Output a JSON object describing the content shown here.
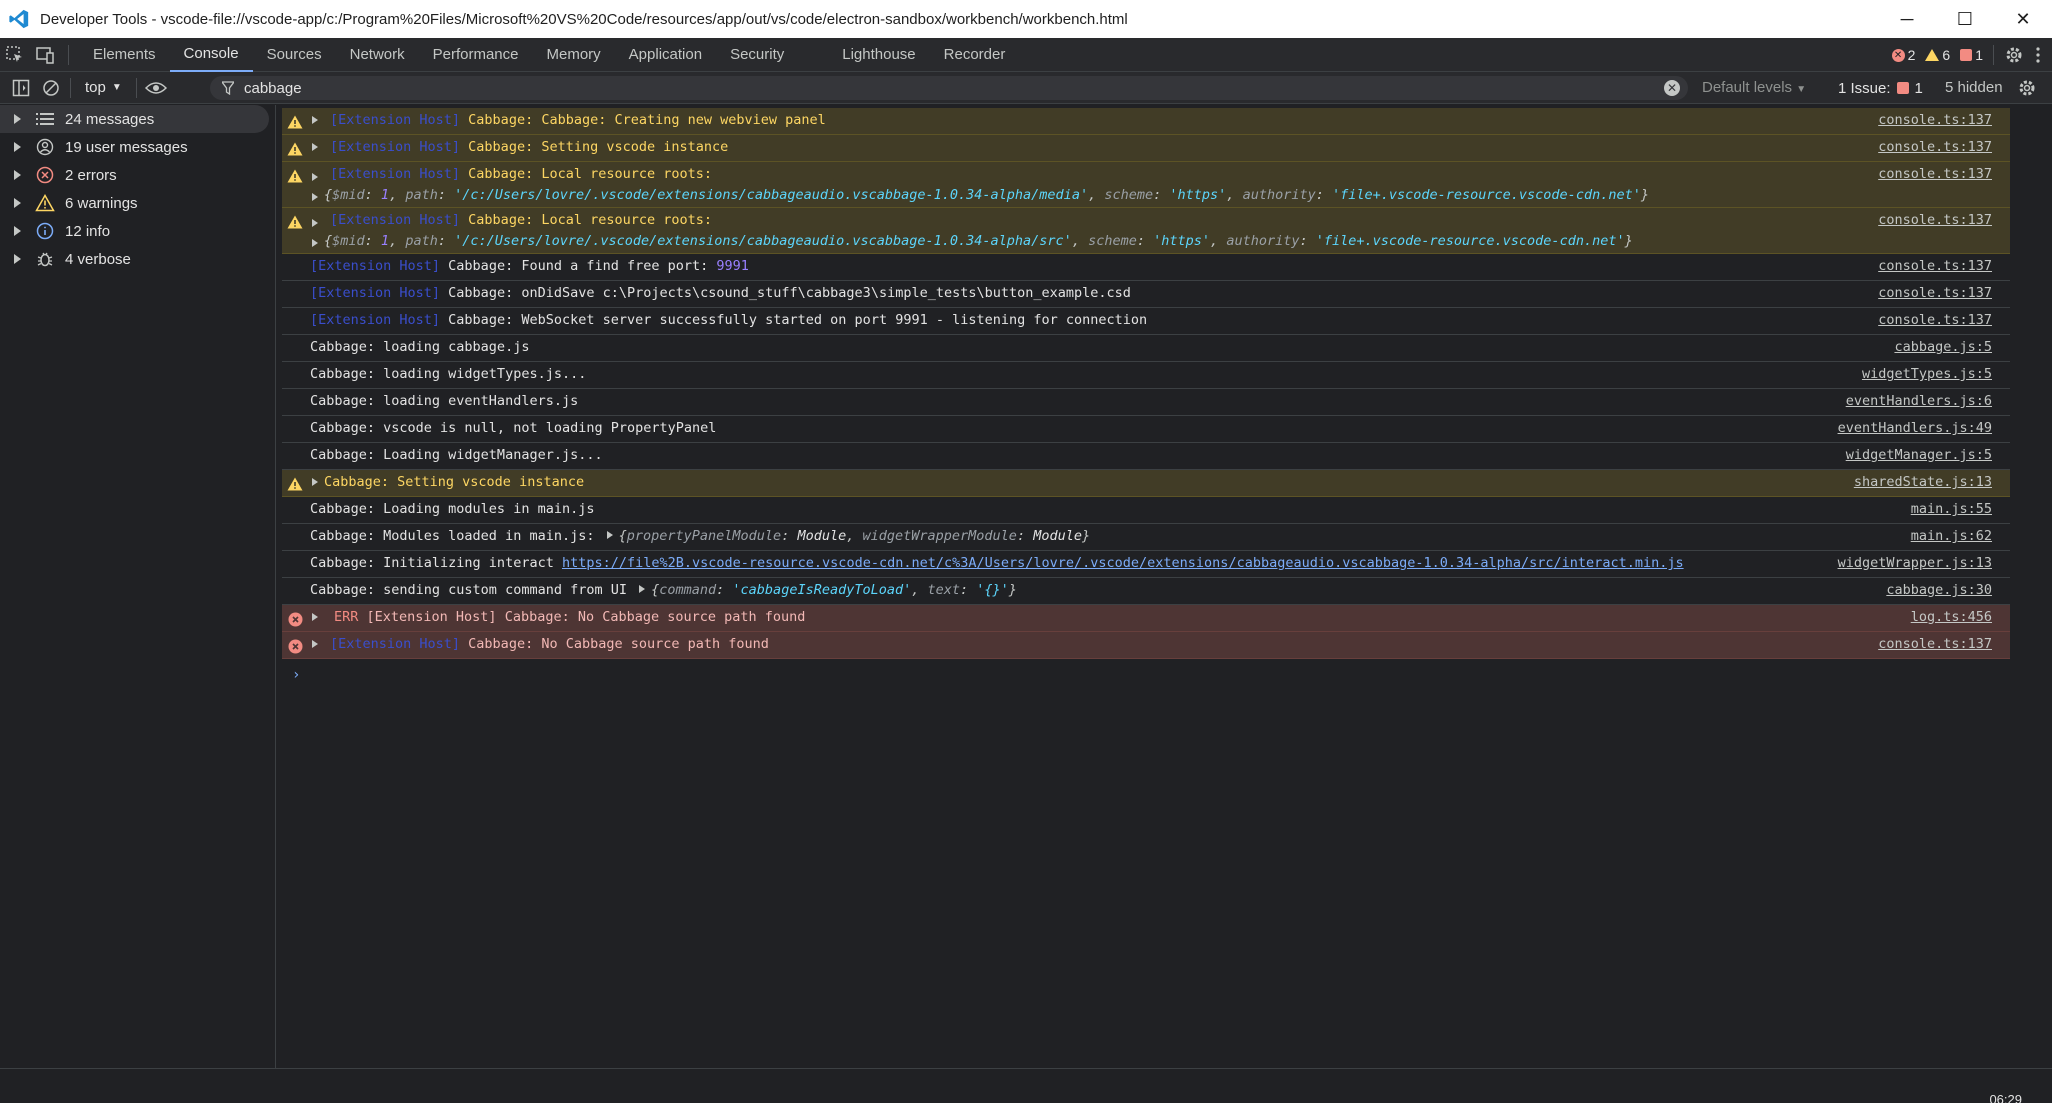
{
  "window": {
    "title": "Developer Tools - vscode-file://vscode-app/c:/Program%20Files/Microsoft%20VS%20Code/resources/app/out/vs/code/electron-sandbox/workbench/workbench.html",
    "minimize": "─",
    "maximize": "☐",
    "close": "✕"
  },
  "tabs": [
    "Elements",
    "Console",
    "Sources",
    "Network",
    "Performance",
    "Memory",
    "Application",
    "Security",
    "Lighthouse",
    "Recorder"
  ],
  "counts": {
    "errors": "2",
    "warnings": "6",
    "issues": "1"
  },
  "console_toolbar": {
    "context": "top",
    "filter_value": "cabbage",
    "levels": "Default levels",
    "issue_label": "1 Issue:",
    "issue_count": "1",
    "hidden": "5 hidden"
  },
  "sidebar": [
    {
      "label": "24 messages",
      "icon": "list-icon"
    },
    {
      "label": "19 user messages",
      "icon": "user-icon"
    },
    {
      "label": "2 errors",
      "icon": "error-icon"
    },
    {
      "label": "6 warnings",
      "icon": "warning-icon"
    },
    {
      "label": "12 info",
      "icon": "info-icon"
    },
    {
      "label": "4 verbose",
      "icon": "bug-icon"
    }
  ],
  "messages": {
    "m1": {
      "tag": "[Extension Host]",
      "text": " Cabbage: Cabbage: Creating new webview panel",
      "src": "console.ts:137"
    },
    "m2": {
      "tag": "[Extension Host]",
      "text": " Cabbage: Setting vscode instance",
      "src": "console.ts:137"
    },
    "m3": {
      "tag": "[Extension Host]",
      "text": " Cabbage: Local resource roots:",
      "src": "console.ts:137",
      "obj_open": "{",
      "k1": "$mid",
      "n1": "1",
      "k2": "path",
      "s2": "'/c:/Users/lovre/.vscode/extensions/cabbageaudio.vscabbage-1.0.34-alpha/media'",
      "k3": "scheme",
      "s3": "'https'",
      "k4": "authority",
      "s4": "'file+.vscode-resource.vscode-cdn.net'",
      "obj_close": "}"
    },
    "m4": {
      "tag": "[Extension Host]",
      "text": " Cabbage: Local resource roots:",
      "src": "console.ts:137",
      "obj_open": "{",
      "k1": "$mid",
      "n1": "1",
      "k2": "path",
      "s2": "'/c:/Users/lovre/.vscode/extensions/cabbageaudio.vscabbage-1.0.34-alpha/src'",
      "k3": "scheme",
      "s3": "'https'",
      "k4": "authority",
      "s4": "'file+.vscode-resource.vscode-cdn.net'",
      "obj_close": "}"
    },
    "m5": {
      "tag": "[Extension Host]",
      "text": " Cabbage: Found a find free port: ",
      "num": "9991",
      "src": "console.ts:137"
    },
    "m6": {
      "tag": "[Extension Host]",
      "text": " Cabbage: onDidSave c:\\Projects\\csound_stuff\\cabbage3\\simple_tests\\button_example.csd",
      "src": "console.ts:137"
    },
    "m7": {
      "tag": "[Extension Host]",
      "text": " Cabbage: WebSocket server successfully started on port 9991 - listening for connection",
      "src": "console.ts:137"
    },
    "m8": {
      "text": "Cabbage: loading cabbage.js",
      "src": "cabbage.js:5"
    },
    "m9": {
      "text": "Cabbage: loading widgetTypes.js...",
      "src": "widgetTypes.js:5"
    },
    "m10": {
      "text": "Cabbage: loading eventHandlers.js",
      "src": "eventHandlers.js:6"
    },
    "m11": {
      "text": "Cabbage: vscode is null, not loading PropertyPanel",
      "src": "eventHandlers.js:49"
    },
    "m12": {
      "text": "Cabbage: Loading widgetManager.js...",
      "src": "widgetManager.js:5"
    },
    "m13": {
      "text": "Cabbage: Setting vscode instance",
      "src": "sharedState.js:13"
    },
    "m14": {
      "text": "Cabbage: Loading modules in main.js",
      "src": "main.js:55"
    },
    "m15": {
      "text": "Cabbage: Modules loaded in main.js: ",
      "obj_open": "{",
      "k1": "propertyPanelModule",
      "v1": "Module",
      "k2": "widgetWrapperModule",
      "v2": "Module",
      "obj_close": "}",
      "src": "main.js:62"
    },
    "m16": {
      "text": "Cabbage: Initializing interact ",
      "link": "https://file%2B.vscode-resource.vscode-cdn.net/c%3A/Users/lovre/.vscode/extensions/cabbageaudio.vscabbage-1.0.34-alpha/src/interact.min.js",
      "src": "widgetWrapper.js:13"
    },
    "m17": {
      "text": "Cabbage: sending custom command from UI ",
      "obj_open": "{",
      "k1": "command",
      "s1": "'cabbageIsReadyToLoad'",
      "k2": "text",
      "s2": "'{}'",
      "obj_close": "}",
      "src": "cabbage.js:30"
    },
    "m18": {
      "err": "ERR",
      "text": " [Extension Host] Cabbage: No Cabbage source path found",
      "src": "log.ts:456"
    },
    "m19": {
      "tag": "[Extension Host]",
      "text": " Cabbage: No Cabbage source path found",
      "src": "console.ts:137"
    }
  },
  "prompt": "›",
  "clock": "06:29",
  "colors": {
    "warn_bg": "#413c26",
    "err_bg": "#4e3534",
    "accent": "#7cacf8"
  }
}
